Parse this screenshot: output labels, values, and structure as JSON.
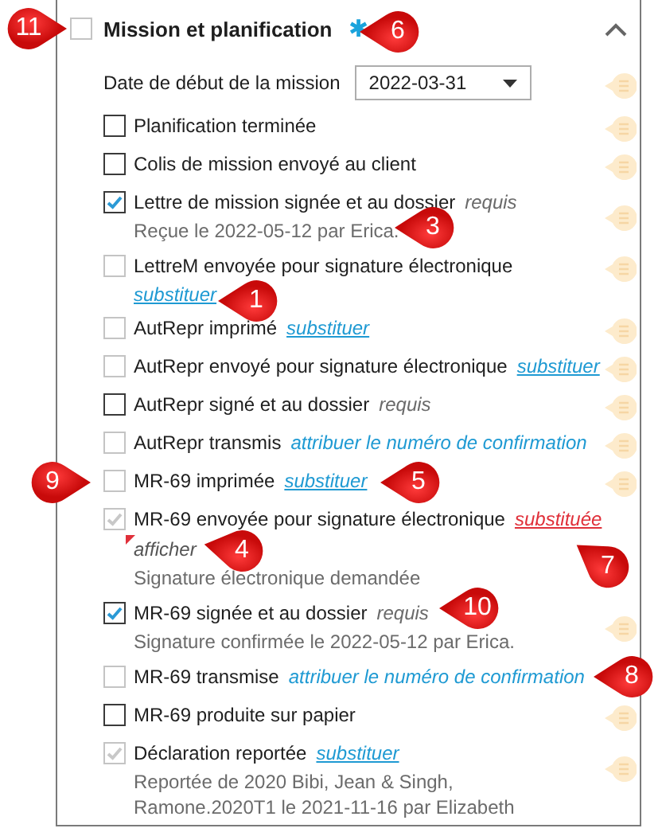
{
  "header": {
    "title": "Mission et planification",
    "checked": false,
    "required_mark": "✱"
  },
  "date_field": {
    "label": "Date de début de la mission",
    "value": "2022-03-31"
  },
  "items": [
    {
      "label": "Planification terminée",
      "checked": false,
      "disabled": false
    },
    {
      "label": "Colis de mission envoyé au client",
      "checked": false,
      "disabled": false
    },
    {
      "label": "Lettre de mission signée et au dossier",
      "checked": true,
      "disabled": false,
      "tag": {
        "kind": "note",
        "text": "requis"
      },
      "notes": [
        "Reçue le 2022-05-12 par Erica."
      ]
    },
    {
      "label": "LettreM envoyée pour signature électronique",
      "checked": false,
      "disabled": true,
      "tag": {
        "kind": "link",
        "text": "substituer"
      }
    },
    {
      "label": "AutRepr imprimé",
      "checked": false,
      "disabled": true,
      "tag": {
        "kind": "link",
        "text": "substituer"
      }
    },
    {
      "label": "AutRepr envoyé pour signature électronique",
      "checked": false,
      "disabled": true,
      "tag": {
        "kind": "link",
        "text": "substituer"
      }
    },
    {
      "label": "AutRepr signé et au dossier",
      "checked": false,
      "disabled": false,
      "tag": {
        "kind": "note",
        "text": "requis"
      }
    },
    {
      "label": "AutRepr transmis",
      "checked": false,
      "disabled": true,
      "tag": {
        "kind": "action",
        "text": "attribuer le numéro de confirmation"
      }
    },
    {
      "label": "MR-69 imprimée",
      "checked": false,
      "disabled": true,
      "tag": {
        "kind": "link",
        "text": "substituer"
      }
    },
    {
      "label": "MR-69 envoyée pour signature électronique",
      "checked": true,
      "disabled": true,
      "no_comment": true,
      "tag": {
        "kind": "substituted",
        "text": "substituée"
      },
      "toggle": "afficher",
      "notes": [
        "Signature électronique demandée"
      ]
    },
    {
      "label": "MR-69 signée et au dossier",
      "checked": true,
      "disabled": false,
      "tag": {
        "kind": "note",
        "text": "requis"
      },
      "notes": [
        "Signature confirmée le 2022-05-12 par Erica."
      ]
    },
    {
      "label": "MR-69 transmise",
      "checked": false,
      "disabled": true,
      "no_comment": true,
      "tag": {
        "kind": "action",
        "text": "attribuer le numéro de confirmation"
      }
    },
    {
      "label": "MR-69 produite sur papier",
      "checked": false,
      "disabled": false
    },
    {
      "label": "Déclaration reportée",
      "checked": true,
      "disabled": true,
      "tag": {
        "kind": "link",
        "text": "substituer"
      },
      "notes": [
        "Reportée de 2020 Bibi, Jean & Singh, Ramone.2020T1 le 2021-11-16 par Elizabeth"
      ]
    }
  ],
  "callouts": [
    {
      "number": "11"
    },
    {
      "number": "6"
    },
    {
      "number": "3"
    },
    {
      "number": "1"
    },
    {
      "number": "9"
    },
    {
      "number": "5"
    },
    {
      "number": "4"
    },
    {
      "number": "7"
    },
    {
      "number": "10"
    },
    {
      "number": "8"
    }
  ]
}
